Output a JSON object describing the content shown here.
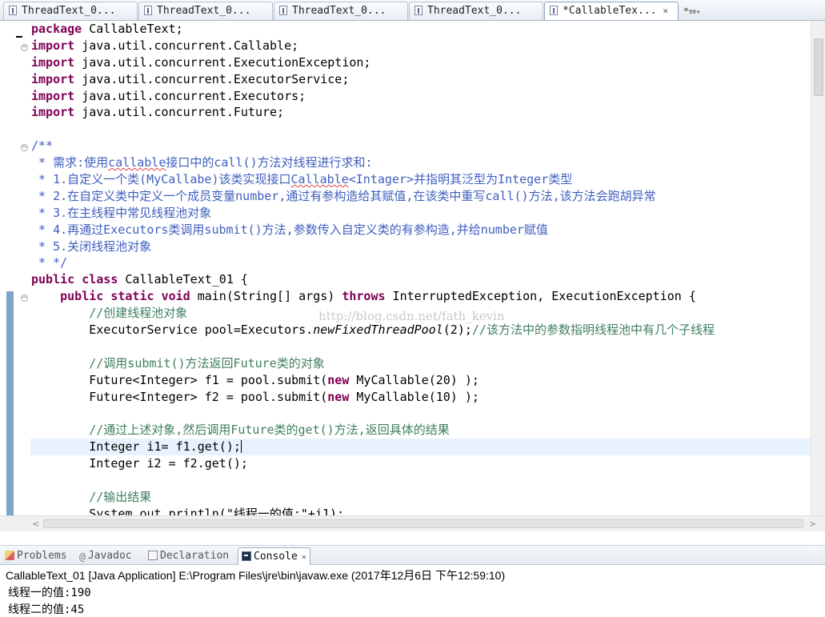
{
  "editor_tabs": [
    {
      "label": "ThreadText_0...",
      "active": false
    },
    {
      "label": "ThreadText_0...",
      "active": false
    },
    {
      "label": "ThreadText_0...",
      "active": false
    },
    {
      "label": "ThreadText_0...",
      "active": false
    },
    {
      "label": "*CallableTex...",
      "active": true
    }
  ],
  "tab_overflow": {
    "label": "»",
    "count": "99+"
  },
  "code": {
    "package_kw": "package",
    "package_name": " CallableText;",
    "import_kw": "import",
    "imports": [
      " java.util.concurrent.Callable;",
      " java.util.concurrent.ExecutionException;",
      " java.util.concurrent.ExecutorService;",
      " java.util.concurrent.Executors;",
      " java.util.concurrent.Future;"
    ],
    "doc_open": "/**",
    "doc_lines": [
      {
        "pre": " * 需求:使用",
        "sq": "callable",
        "post": "接口中的call()方法对线程进行求和:"
      },
      {
        "pre": " * 1.自定义一个类(MyCallabe)该类实现接口",
        "sq": "Callable",
        "post": "<Intager>并指明其泛型为Integer类型"
      },
      {
        "pre": " * 2.在自定义类中定义一个成员变量number,通过有参构造给其赋值,在该类中重写call()方法,该方法会跑胡异常",
        "sq": "",
        "post": ""
      },
      {
        "pre": " * 3.在主线程中常见线程池对象",
        "sq": "",
        "post": ""
      },
      {
        "pre": " * 4.再通过Executors类调用submit()方法,参数传入自定义类的有参构造,并给number赋值",
        "sq": "",
        "post": ""
      },
      {
        "pre": " * 5.关闭线程池对象",
        "sq": "",
        "post": ""
      }
    ],
    "doc_close": " * */",
    "kw_public": "public",
    "kw_class": "class",
    "kw_static": "static",
    "kw_void": "void",
    "kw_throws": "throws",
    "kw_new": "new",
    "class_name": " CallableText_01 {",
    "main_sig": " main(String[] args) ",
    "main_exceptions": " InterruptedException, ExecutionException {",
    "c1": "//创建线程池对象",
    "pool_pre": "ExecutorService pool=Executors.",
    "pool_method": "newFixedThreadPool",
    "pool_post": "(2);",
    "c2": "//该方法中的参数指明线程池中有几个子线程",
    "c3": "//调用submit()方法返回Future类的对象",
    "f1_pre": "Future<Integer> f1 = pool.submit(",
    "f1_post": " MyCallable(20) );",
    "f2_pre": "Future<Integer> f2 = pool.submit(",
    "f2_post": " MyCallable(10) );",
    "c4": "//通过上述对象,然后调用Future类的get()方法,返回具体的结果",
    "i1": "Integer i1= f1.get();",
    "i2": "Integer i2 = f2.get();",
    "c5": "//输出结果",
    "partial": "System.out.println(\"线程一的值:\"+i1);"
  },
  "watermark": "http://blog.csdn.net/fath_kevin",
  "views": [
    {
      "label": "Problems",
      "icon": "problems-icon",
      "active": false
    },
    {
      "label": "Javadoc",
      "icon": "javadoc-icon",
      "active": false
    },
    {
      "label": "Declaration",
      "icon": "declaration-icon",
      "active": false
    },
    {
      "label": "Console",
      "icon": "console-icon",
      "active": true
    }
  ],
  "console": {
    "header": "CallableText_01 [Java Application] E:\\Program Files\\jre\\bin\\javaw.exe (2017年12月6日 下午12:59:10)",
    "lines": [
      "线程一的值:190",
      "线程二的值:45"
    ]
  }
}
